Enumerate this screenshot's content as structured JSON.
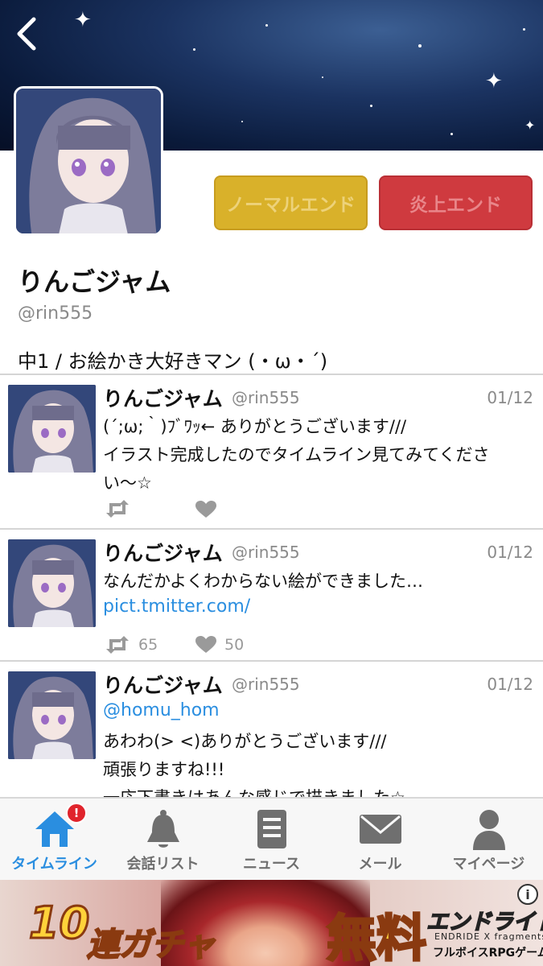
{
  "profile": {
    "name": "りんごジャム",
    "handle": "@rin555",
    "bio": "中1 / お絵かき大好きマン (・ω・´)"
  },
  "endings": {
    "normal": "ノーマルエンド",
    "fire": "炎上エンド"
  },
  "tweets": [
    {
      "name": "りんごジャム",
      "handle": "@rin555",
      "date": "01/12",
      "lines": [
        "(´;ω;｀)ﾌﾞﾜｯ← ありがとうございます///",
        "イラスト完成したのでタイムライン見てみてくださ",
        "い〜☆"
      ],
      "retweets": "",
      "likes": ""
    },
    {
      "name": "りんごジャム",
      "handle": "@rin555",
      "date": "01/12",
      "lines": [
        "なんだかよくわからない絵ができました…"
      ],
      "link": "pict.tmitter.com/",
      "retweets": "65",
      "likes": "50"
    },
    {
      "name": "りんごジャム",
      "handle": "@rin555",
      "date": "01/12",
      "mention": "@homu_hom",
      "lines": [
        "あわわ(> <)ありがとうございます///",
        "頑張りますね!!!",
        "一応下書きはあんな感じで描きました☆"
      ]
    }
  ],
  "nav": {
    "items": [
      {
        "label": "タイムライン",
        "icon": "home-icon",
        "active": true
      },
      {
        "label": "会話リスト",
        "icon": "bell-icon"
      },
      {
        "label": "ニュース",
        "icon": "news-icon"
      },
      {
        "label": "メール",
        "icon": "mail-icon"
      },
      {
        "label": "マイページ",
        "icon": "person-icon"
      }
    ],
    "badge": "!"
  },
  "ad": {
    "count": "10",
    "gacha": "連ガチャ",
    "free": "無料",
    "logo": "エンドライド",
    "subtitle": "ENDRIDE X fragments",
    "genre": "フルボイスRPGゲーム",
    "info": "i"
  },
  "colors": {
    "accent": "#2a8ee0",
    "normal_end": "#d9b12a",
    "fire_end": "#cf3a3f",
    "badge": "#e0242c"
  }
}
